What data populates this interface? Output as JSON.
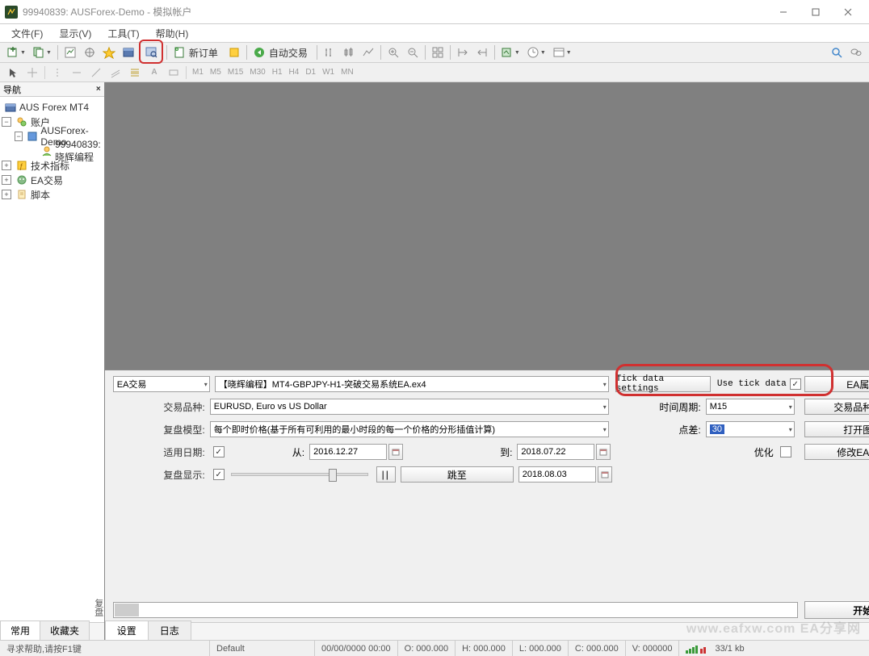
{
  "title": "99940839: AUSForex-Demo - 模拟帐户",
  "menubar": [
    "文件(F)",
    "显示(V)",
    "工具(T)",
    "帮助(H)"
  ],
  "toolbar": {
    "new_order": "新订单",
    "auto_trade": "自动交易"
  },
  "timeframes": [
    "M1",
    "M5",
    "M15",
    "M30",
    "H1",
    "H4",
    "D1",
    "W1",
    "MN"
  ],
  "nav": {
    "title": "导航",
    "root": "AUS Forex MT4",
    "accounts": "账户",
    "broker": "AUSForex-Demo",
    "login": "99940839: 晓辉编程",
    "indicators": "技术指标",
    "ea": "EA交易",
    "scripts": "脚本",
    "tabs": {
      "common": "常用",
      "fav": "收藏夹"
    }
  },
  "tester": {
    "type_label": "EA交易",
    "ea_file": "【晓辉编程】MT4-GBPJPY-H1-突破交易系统EA.ex4",
    "tick_settings": "Tick data settings",
    "use_tick": "Use tick data",
    "ea_props": "EA属性",
    "symbol_label": "交易品种:",
    "symbol": "EURUSD, Euro vs US Dollar",
    "period_label": "时间周期:",
    "period": "M15",
    "symbol_props": "交易品种属性",
    "model_label": "复盘模型:",
    "model": "每个即时价格(基于所有可利用的最小时段的每一个价格的分形插值计算)",
    "spread_label": "点差:",
    "spread": "30",
    "open_chart": "打开图表",
    "use_date_label": "适用日期:",
    "from_label": "从:",
    "from_date": "2016.12.27",
    "to_label": "到:",
    "to_date": "2018.07.22",
    "optimize_label": "优化",
    "modify_ea": "修改EA交易",
    "visual_label": "复盘显示:",
    "skip_to": "跳至",
    "skip_date": "2018.08.03",
    "start": "开始",
    "tabs": {
      "settings": "设置",
      "journal": "日志"
    },
    "vtab": "复盘"
  },
  "statusbar": {
    "help": "寻求帮助,请按F1键",
    "profile": "Default",
    "time": "00/00/0000 00:00",
    "o": "O: 000.000",
    "h": "H: 000.000",
    "l": "L: 000.000",
    "c": "C: 000.000",
    "v": "V: 000000",
    "net": "33/1 kb"
  },
  "watermark": "www.eafxw.com EA分享网"
}
